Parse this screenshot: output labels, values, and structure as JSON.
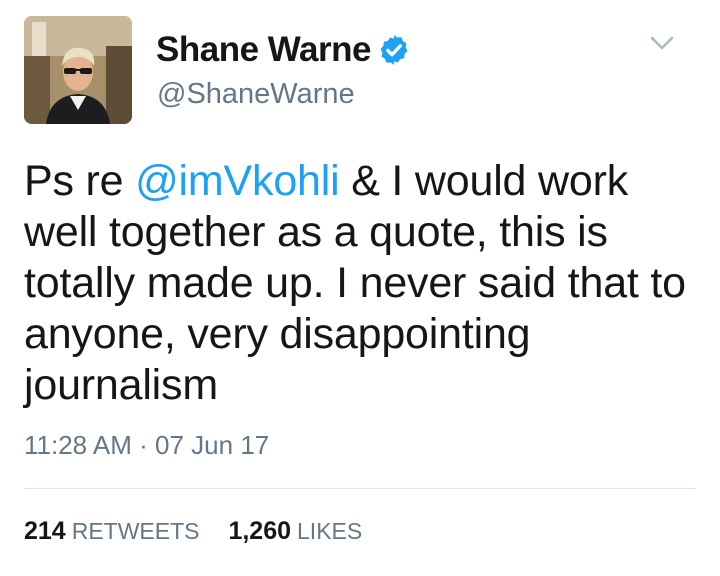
{
  "tweet": {
    "author": {
      "display_name": "Shane Warne",
      "handle": "@ShaneWarne",
      "verified": true,
      "avatar_icon": "profile-photo"
    },
    "text": {
      "prefix": "Ps re ",
      "mention": "@imVkohli",
      "suffix": " & I would work well together as a quote, this is totally made up. I never said that to anyone, very disappointing journalism"
    },
    "timestamp": "11:28 AM · 07 Jun 17",
    "stats": {
      "retweets_count": "214",
      "retweets_label": "RETWEETS",
      "likes_count": "1,260",
      "likes_label": "LIKES"
    },
    "icons": {
      "verified": "verified-badge-icon",
      "menu": "chevron-down-icon"
    },
    "colors": {
      "accent": "#1da1f2",
      "text": "#14171a",
      "secondary_text": "#657786",
      "divider": "#e1e8ed"
    }
  }
}
